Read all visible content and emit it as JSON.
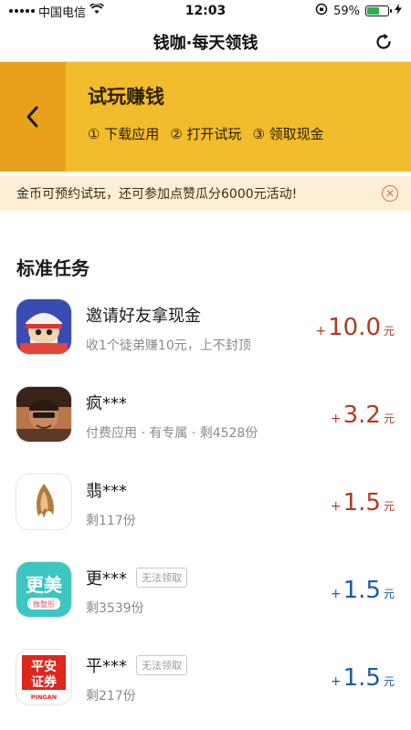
{
  "status_bar": {
    "carrier": "中国电信",
    "time": "12:03",
    "battery": "59%",
    "battery_level": 0.59
  },
  "nav": {
    "title": "钱咖·每天领钱"
  },
  "banner": {
    "title": "试玩赚钱",
    "steps": [
      "① 下载应用",
      "② 打开试玩",
      "③ 领取现金"
    ]
  },
  "notice": {
    "text": "金币可预约试玩，还可参加点赞瓜分6000元活动!"
  },
  "section": {
    "title": "标准任务"
  },
  "tasks": [
    {
      "name": "邀请好友拿现金",
      "sub": "收1个徒弟赚10元，上不封顶",
      "plus": "+",
      "amount": "10.0",
      "unit": "元",
      "tag": "",
      "color": "#b23a1f",
      "icon": "invite-friend-app-icon"
    },
    {
      "name": "疯***",
      "sub": "付费应用 · 有专属 · 剩4528份",
      "plus": "+",
      "amount": "3.2",
      "unit": "元",
      "tag": "",
      "color": "#b23a1f",
      "icon": "game-character-app-icon"
    },
    {
      "name": "翡***",
      "sub": "剩117份",
      "plus": "+",
      "amount": "1.5",
      "unit": "元",
      "tag": "",
      "color": "#b23a1f",
      "icon": "feather-flame-app-icon"
    },
    {
      "name": "更***",
      "sub": "剩3539份",
      "plus": "+",
      "amount": "1.5",
      "unit": "元",
      "tag": "无法领取",
      "color": "#1d5aa6",
      "icon": "gengmei-app-icon",
      "icon_text": "更美",
      "icon_sub": "微整形"
    },
    {
      "name": "平***",
      "sub": "剩217份",
      "plus": "+",
      "amount": "1.5",
      "unit": "元",
      "tag": "无法领取",
      "color": "#1d5aa6",
      "icon": "pingan-securities-app-icon",
      "icon_text1": "平安",
      "icon_text2": "证券",
      "icon_sub": "PINGAN"
    }
  ]
}
